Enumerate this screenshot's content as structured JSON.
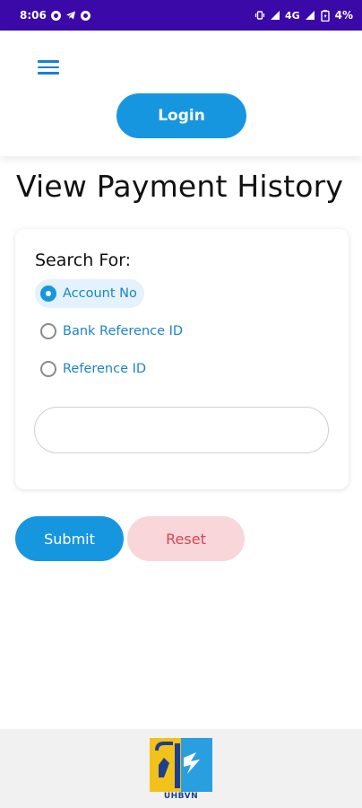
{
  "status_bar": {
    "time": "8:06",
    "network": "4G",
    "battery": "4%"
  },
  "header": {
    "login_label": "Login"
  },
  "page": {
    "title": "View Payment History"
  },
  "search": {
    "label": "Search For:",
    "options": [
      {
        "label": "Account No",
        "selected": true
      },
      {
        "label": "Bank Reference ID",
        "selected": false
      },
      {
        "label": "Reference ID",
        "selected": false
      }
    ],
    "input_value": "",
    "input_placeholder": ""
  },
  "actions": {
    "submit_label": "Submit",
    "reset_label": "Reset"
  },
  "footer": {
    "logo_text": "UHBVN"
  },
  "colors": {
    "status_bar": "#3a09a8",
    "primary": "#1796e0",
    "reset_bg": "#f8d6da",
    "reset_text": "#d64556"
  }
}
